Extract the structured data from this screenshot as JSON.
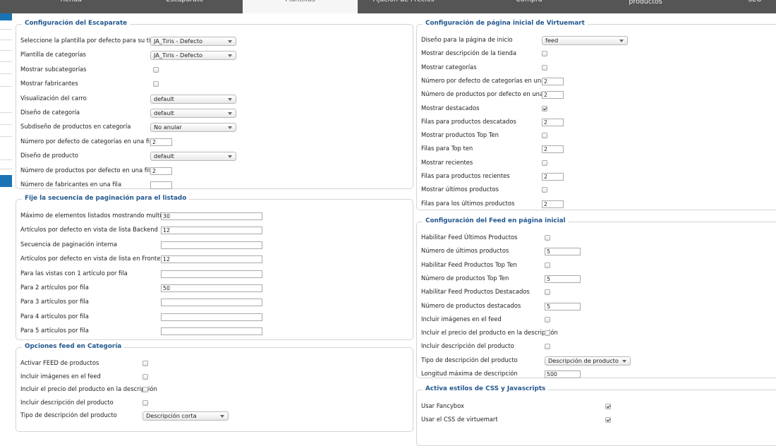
{
  "tabs": [
    {
      "label": "Tienda"
    },
    {
      "label": "Escaparate"
    },
    {
      "label": "Plantillas",
      "active": true
    },
    {
      "label": "Fijación de Precios"
    },
    {
      "label": "Compra"
    },
    {
      "label": "Configuración del orden de productos"
    },
    {
      "label": "SEO"
    }
  ],
  "escaparate": {
    "legend": "Configuración del Escaparate",
    "rows": [
      {
        "label": "Seleccione la plantilla por defecto para su tienda",
        "type": "select",
        "value": "JA_Tiris - Defecto"
      },
      {
        "label": "Plantilla de categorías",
        "type": "select",
        "value": "JA_Tiris - Defecto"
      },
      {
        "label": "Mostrar subcategorías",
        "type": "checkbox",
        "checked": false
      },
      {
        "label": "Mostrar fabricantes",
        "type": "checkbox",
        "checked": false
      },
      {
        "label": "Visualización del carro",
        "type": "select",
        "value": "default"
      },
      {
        "label": "Diseño de categoría",
        "type": "select",
        "value": "default"
      },
      {
        "label": "Subdiseño de productos en categoría",
        "type": "select",
        "value": "No anular"
      },
      {
        "label": "Número por defecto de categorías en una fila",
        "type": "input",
        "value": "2"
      },
      {
        "label": "Diseño de producto",
        "type": "select",
        "value": "default"
      },
      {
        "label": "Número de productos por defecto en una fila",
        "type": "input",
        "value": "2"
      },
      {
        "label": "Número de fabricantes en una fila",
        "type": "input",
        "value": ""
      }
    ]
  },
  "paginacion": {
    "legend": "Fije la secuencia de paginación para el listado",
    "rows": [
      {
        "label": "Máximo de elementos listados mostrando multimedia",
        "value": "30"
      },
      {
        "label": "Artículos por defecto en vista de lista Backend",
        "value": "12"
      },
      {
        "label": "Secuencia de paginación interna",
        "value": ""
      },
      {
        "label": "Artículos por defecto en vista de lista en Frontend",
        "value": "12"
      },
      {
        "label": "Para las vistas con 1 artículo por fila",
        "value": ""
      },
      {
        "label": "Para 2 artículos por fila",
        "value": "50"
      },
      {
        "label": "Para 3 artículos por fila",
        "value": ""
      },
      {
        "label": "Para 4 artículos por fila",
        "value": ""
      },
      {
        "label": "Para 5 artículos por fila",
        "value": ""
      }
    ]
  },
  "feedcat": {
    "legend": "Opciones feed en Categoría",
    "rows": [
      {
        "label": "Activar FEED de productos",
        "type": "checkbox",
        "checked": false
      },
      {
        "label": "Incluir imágenes en el feed",
        "type": "checkbox",
        "checked": false
      },
      {
        "label": "Incluir el precio del producto en la descripción",
        "type": "checkbox",
        "checked": false
      },
      {
        "label": "Incluir descripción del producto",
        "type": "checkbox",
        "checked": false
      },
      {
        "label": "Tipo de descripción del producto",
        "type": "select",
        "value": "Descripción corta"
      }
    ]
  },
  "inicio": {
    "legend": "Configuración de página inicial de Virtuemart",
    "rows": [
      {
        "label": "Diseño para la página de inicio",
        "type": "select",
        "value": "feed"
      },
      {
        "label": "Mostrar descripción de la tienda",
        "type": "checkbox",
        "checked": false
      },
      {
        "label": "Mostrar categorías",
        "type": "checkbox",
        "checked": false
      },
      {
        "label": "Número por defecto de categorías en una fila",
        "type": "input",
        "value": "2"
      },
      {
        "label": "Número de productos por defecto en una fila",
        "type": "input",
        "value": "2"
      },
      {
        "label": "Mostrar destacados",
        "type": "checkbox",
        "checked": true
      },
      {
        "label": "Filas para productos descatados",
        "type": "input",
        "value": "2"
      },
      {
        "label": "Mostrar productos Top Ten",
        "type": "checkbox",
        "checked": false
      },
      {
        "label": "Filas para Top ten",
        "type": "input",
        "value": "2"
      },
      {
        "label": "Mostrar recientes",
        "type": "checkbox",
        "checked": false
      },
      {
        "label": "Filas para productos recientes",
        "type": "input",
        "value": "2"
      },
      {
        "label": "Mostrar últimos productos",
        "type": "checkbox",
        "checked": false
      },
      {
        "label": "Filas para los últimos productos",
        "type": "input",
        "value": "2"
      }
    ]
  },
  "feedinicio": {
    "legend": "Configuración del Feed en página inicial",
    "rows": [
      {
        "label": "Habilitar Feed Últimos Productos",
        "type": "checkbox",
        "checked": false
      },
      {
        "label": "Número de últimos productos",
        "type": "input",
        "value": "5"
      },
      {
        "label": "Habilitar Feed Productos Top Ten",
        "type": "checkbox",
        "checked": false
      },
      {
        "label": "Número de productos Top Ten",
        "type": "input",
        "value": "5"
      },
      {
        "label": "Habilitar Feed Productos Destacados",
        "type": "checkbox",
        "checked": false
      },
      {
        "label": "Número de productos destacados",
        "type": "input",
        "value": "5"
      },
      {
        "label": "Incluir imágenes en el feed",
        "type": "checkbox",
        "checked": false
      },
      {
        "label": "Incluir el precio del producto en la descripción",
        "type": "checkbox",
        "checked": false
      },
      {
        "label": "Incluir descripción del producto",
        "type": "checkbox",
        "checked": false
      },
      {
        "label": "Tipo de descripción del producto",
        "type": "select",
        "value": "Descripción de producto"
      },
      {
        "label": "Longitud máxima de descripción",
        "type": "input",
        "value": "500"
      }
    ]
  },
  "css": {
    "legend": "Activa estilos de CSS y Javascripts",
    "rows": [
      {
        "label": "Usar Fancybox",
        "type": "checkbox",
        "checked": true
      },
      {
        "label": "Usar el CSS de virtuemart",
        "type": "checkbox",
        "checked": true
      }
    ]
  }
}
